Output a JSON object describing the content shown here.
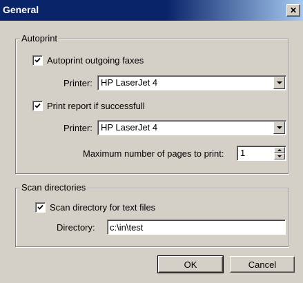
{
  "window": {
    "title": "General",
    "close_glyph": "✕"
  },
  "autoprint": {
    "group_label": "Autoprint",
    "outgoing": {
      "label": "Autoprint outgoing faxes",
      "checked": true
    },
    "printer1": {
      "label": "Printer:",
      "value": "HP LaserJet 4"
    },
    "report": {
      "label": "Print report if successfull",
      "checked": true
    },
    "printer2": {
      "label": "Printer:",
      "value": "HP LaserJet 4"
    },
    "max_pages": {
      "label": "Maximum number of pages to print:",
      "value": "1"
    }
  },
  "scan": {
    "group_label": "Scan directories",
    "scan_dir": {
      "label": "Scan directory for text files",
      "checked": true
    },
    "directory": {
      "label": "Directory:",
      "value": "c:\\in\\test"
    }
  },
  "buttons": {
    "ok": "OK",
    "cancel": "Cancel"
  },
  "icons": {
    "check": "check-icon",
    "close": "close-icon",
    "dropdown": "chevron-down-icon"
  }
}
